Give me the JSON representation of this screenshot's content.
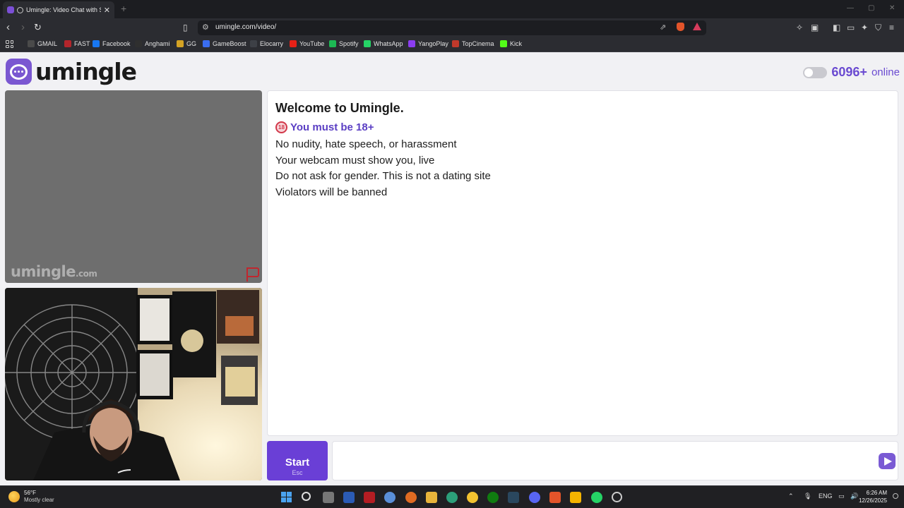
{
  "browser": {
    "tab_title": "Umingle: Video Chat with Str...",
    "new_tab_label": "+",
    "url": "umingle.com/video/"
  },
  "bookmarks": [
    {
      "label": "GMAIL",
      "color": "#4a4a4a"
    },
    {
      "label": "FAST",
      "color": "#b3252b"
    },
    {
      "label": "Facebook",
      "color": "#1877f2"
    },
    {
      "label": "Anghami",
      "color": "#2f2f2f"
    },
    {
      "label": "GG",
      "color": "#d4a324"
    },
    {
      "label": "GameBoost",
      "color": "#3a6df0"
    },
    {
      "label": "Elocarry",
      "color": "#3d4046"
    },
    {
      "label": "YouTube",
      "color": "#e62117"
    },
    {
      "label": "Spotify",
      "color": "#1db954"
    },
    {
      "label": "WhatsApp",
      "color": "#25d366"
    },
    {
      "label": "YangoPlay",
      "color": "#8b3df0"
    },
    {
      "label": "TopCinema",
      "color": "#c0392b"
    },
    {
      "label": "Kick",
      "color": "#53fc18"
    }
  ],
  "site": {
    "brand": "umingle",
    "online_count": "6096+",
    "online_label": "online",
    "watermark": "umingle",
    "watermark_suffix": ".com",
    "accent_color": "#6a4ad1"
  },
  "chat": {
    "welcome": "Welcome to Umingle.",
    "age_badge": "18",
    "age_rule": "You must be 18+",
    "rules": [
      "No nudity, hate speech, or harassment",
      "Your webcam must show you, live",
      "Do not ask for gender. This is not a dating site",
      "Violators will be banned"
    ],
    "input_placeholder": ""
  },
  "controls": {
    "start_label": "Start",
    "start_shortcut": "Esc"
  },
  "taskbar": {
    "temperature": "56°F",
    "weather": "Mostly clear",
    "language": "ENG",
    "time": "6:26 AM",
    "date": "12/26/2025"
  }
}
